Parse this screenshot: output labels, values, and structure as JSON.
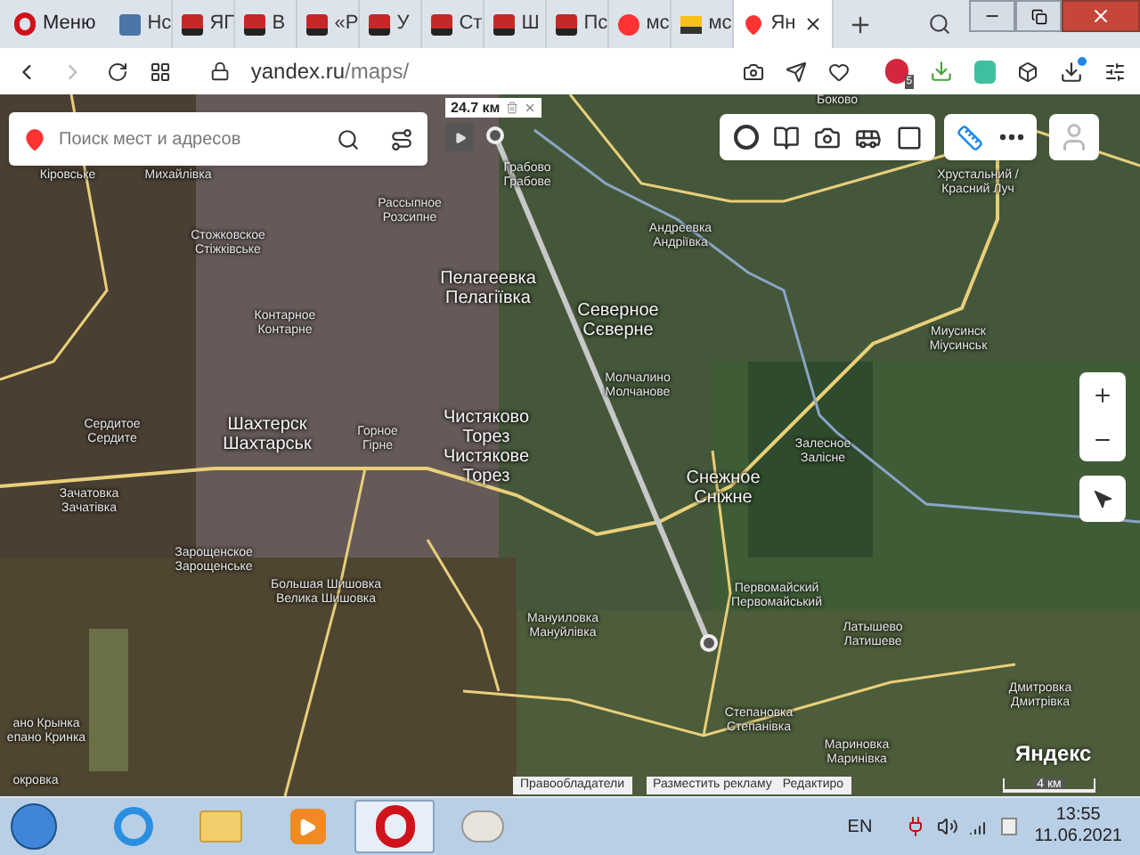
{
  "browser": {
    "menu_label": "Меню",
    "tabs": [
      {
        "kind": "vk",
        "label": "Нс",
        "selected": false
      },
      {
        "kind": "yaplakal",
        "label": "ЯГ",
        "selected": false
      },
      {
        "kind": "yaplakal",
        "label": "В",
        "selected": false
      },
      {
        "kind": "yaplakal",
        "label": "«Р",
        "selected": false
      },
      {
        "kind": "yaplakal",
        "label": "У",
        "selected": false
      },
      {
        "kind": "yaplakal",
        "label": "Ст",
        "selected": false
      },
      {
        "kind": "yaplakal",
        "label": "Ш",
        "selected": false
      },
      {
        "kind": "yaplakal",
        "label": "Пс",
        "selected": false
      },
      {
        "kind": "yandex",
        "label": "мс",
        "selected": false
      },
      {
        "kind": "image",
        "label": "мс",
        "selected": false
      },
      {
        "kind": "maps",
        "label": "Ян",
        "selected": true
      }
    ],
    "url_host": "yandex.ru",
    "url_path": "/maps/",
    "adblock_count": "5",
    "download_badge": true
  },
  "map": {
    "search": {
      "placeholder": "Поиск мест и адресов"
    },
    "ruler": {
      "distance": "24.7 км"
    },
    "toolbar": [
      {
        "kind": "traffic",
        "selected": false
      },
      {
        "kind": "panorama",
        "selected": false
      },
      {
        "kind": "photo",
        "selected": false
      },
      {
        "kind": "transit",
        "selected": false
      },
      {
        "kind": "layers",
        "selected": false
      },
      {
        "kind": "ruler",
        "selected": true
      },
      {
        "kind": "more",
        "selected": false
      }
    ],
    "labels": [
      {
        "kind": "village",
        "lines": [
          "Боково"
        ]
      },
      {
        "kind": "village",
        "lines": [
          "Кіровське"
        ]
      },
      {
        "kind": "village",
        "lines": [
          "Михайлівка"
        ]
      },
      {
        "kind": "village",
        "lines": [
          "Грабово",
          "Грабове"
        ]
      },
      {
        "kind": "village",
        "lines": [
          "Хрустальний /",
          "Красний Луч"
        ]
      },
      {
        "kind": "village",
        "lines": [
          "Рассыпное",
          "Розсипне"
        ]
      },
      {
        "kind": "village",
        "lines": [
          "Стожковское",
          "Стіжківське"
        ]
      },
      {
        "kind": "village",
        "lines": [
          "Андреевка",
          "Андріївка"
        ]
      },
      {
        "kind": "town",
        "lines": [
          "Пелагеевка",
          "Пелагіївка"
        ]
      },
      {
        "kind": "village",
        "lines": [
          "Контарное",
          "Контарне"
        ]
      },
      {
        "kind": "town",
        "lines": [
          "Северное",
          "Сєверне"
        ]
      },
      {
        "kind": "village",
        "lines": [
          "Миусинск",
          "Міусинськ"
        ]
      },
      {
        "kind": "village",
        "lines": [
          "Молчалино",
          "Молчанове"
        ]
      },
      {
        "kind": "village",
        "lines": [
          "Сердитое",
          "Сердите"
        ]
      },
      {
        "kind": "town",
        "lines": [
          "Шахтерск",
          "Шахтарськ"
        ]
      },
      {
        "kind": "village",
        "lines": [
          "Горное",
          "Гірне"
        ]
      },
      {
        "kind": "town",
        "lines": [
          "Чистяково",
          "Торез",
          "Чистякове",
          "Торез"
        ]
      },
      {
        "kind": "village",
        "lines": [
          "Залесное",
          "Залісне"
        ]
      },
      {
        "kind": "village",
        "lines": [
          "Зачатовка",
          "Зачатівка"
        ]
      },
      {
        "kind": "town",
        "lines": [
          "Снежное",
          "Сніжне"
        ]
      },
      {
        "kind": "village",
        "lines": [
          "Зарощенское",
          "Зарощенське"
        ]
      },
      {
        "kind": "village",
        "lines": [
          "Большая Шишовка",
          "Велика Шишовка"
        ]
      },
      {
        "kind": "village",
        "lines": [
          "Первомайский",
          "Первомайський"
        ]
      },
      {
        "kind": "village",
        "lines": [
          "Мануиловка",
          "Мануйлівка"
        ]
      },
      {
        "kind": "village",
        "lines": [
          "Латышево",
          "Латишеве"
        ]
      },
      {
        "kind": "village",
        "lines": [
          "Дмитровка",
          "Дмитрівка"
        ]
      },
      {
        "kind": "village",
        "lines": [
          "ано Крынка",
          "епано Кринка"
        ]
      },
      {
        "kind": "village",
        "lines": [
          "Степановка",
          "Степанівка"
        ]
      },
      {
        "kind": "village",
        "lines": [
          "Мариновка",
          "Маринівка"
        ]
      },
      {
        "kind": "village",
        "lines": [
          "окровка"
        ]
      }
    ],
    "logo": "Яндекс",
    "scale": "4 км",
    "footer_links": [
      "Правообладатели",
      "Разместить рекламу",
      "Редактиро"
    ]
  },
  "taskbar": {
    "apps": [
      {
        "kind": "ie",
        "selected": false
      },
      {
        "kind": "explorer",
        "selected": false
      },
      {
        "kind": "media",
        "selected": false
      },
      {
        "kind": "opera",
        "selected": true
      },
      {
        "kind": "paint",
        "selected": false
      }
    ],
    "language": "EN",
    "time": "13:55",
    "date": "11.06.2021"
  }
}
